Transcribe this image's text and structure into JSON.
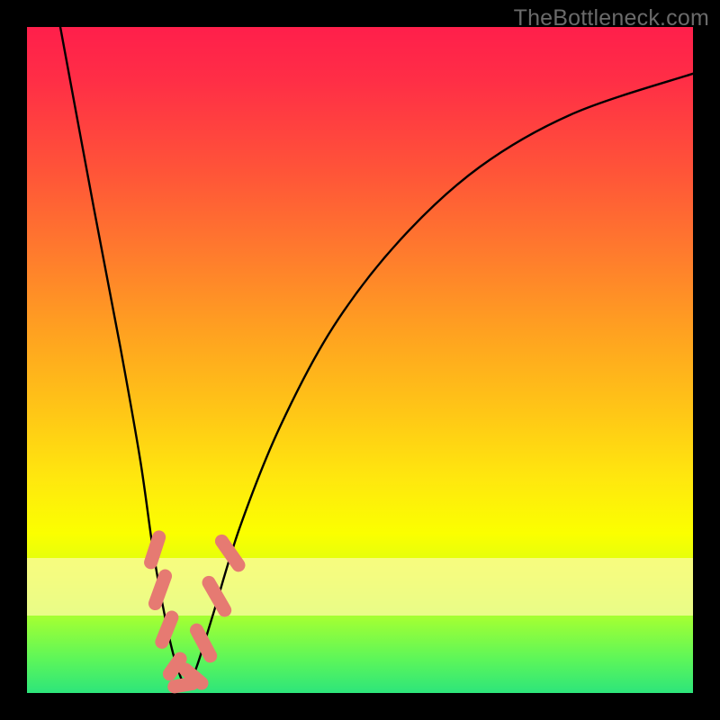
{
  "watermark": "TheBottleneck.com",
  "colors": {
    "lozenge": "#e67a72",
    "curve": "#000000",
    "frame": "#000000"
  },
  "chart_data": {
    "type": "line",
    "title": "",
    "xlabel": "",
    "ylabel": "",
    "xlim": [
      0,
      100
    ],
    "ylim": [
      0,
      100
    ],
    "grid": false,
    "legend": false,
    "series": [
      {
        "name": "bottleneck-curve",
        "x": [
          5,
          10,
          14,
          17,
          19,
          21,
          22.5,
          24,
          25.5,
          28,
          32,
          38,
          46,
          56,
          68,
          82,
          100
        ],
        "y": [
          100,
          73,
          52,
          35,
          21,
          10,
          4,
          1,
          4,
          12,
          25,
          40,
          55,
          68,
          79,
          87,
          93
        ]
      }
    ],
    "markers": [
      {
        "x": 19.2,
        "y": 21.5,
        "len": 3.0,
        "angle_deg": -72
      },
      {
        "x": 20.0,
        "y": 15.5,
        "len": 3.2,
        "angle_deg": -70
      },
      {
        "x": 21.0,
        "y": 9.5,
        "len": 3.0,
        "angle_deg": -68
      },
      {
        "x": 22.2,
        "y": 4.0,
        "len": 2.4,
        "angle_deg": -55
      },
      {
        "x": 23.5,
        "y": 1.2,
        "len": 2.4,
        "angle_deg": -10
      },
      {
        "x": 25.0,
        "y": 2.5,
        "len": 2.6,
        "angle_deg": 40
      },
      {
        "x": 26.5,
        "y": 7.5,
        "len": 3.2,
        "angle_deg": 62
      },
      {
        "x": 28.5,
        "y": 14.5,
        "len": 3.4,
        "angle_deg": 60
      },
      {
        "x": 30.5,
        "y": 21.0,
        "len": 3.2,
        "angle_deg": 55
      }
    ]
  }
}
